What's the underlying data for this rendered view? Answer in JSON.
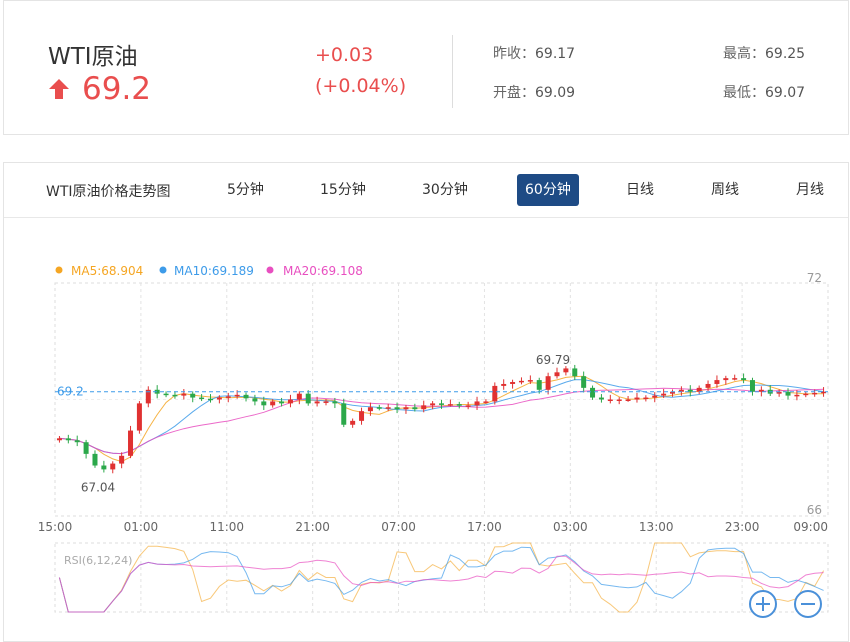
{
  "quote": {
    "name": "WTI原油",
    "last": "69.2",
    "change": "+0.03",
    "change_pct": "(+0.04%)",
    "prev_close_label": "昨收：",
    "prev_close": "69.17",
    "open_label": "开盘：",
    "open": "69.09",
    "high_label": "最高：",
    "high": "69.25",
    "low_label": "最低：",
    "low": "69.07",
    "up_color": "#e94e4e"
  },
  "tabs": {
    "title": "WTI原油价格走势图",
    "items": [
      "5分钟",
      "15分钟",
      "30分钟",
      "60分钟",
      "日线",
      "周线",
      "月线"
    ],
    "active": "60分钟",
    "active_color": "#1e4b85"
  },
  "legend": {
    "ma5": "MA5:68.904",
    "ma10": "MA10:69.189",
    "ma20": "MA20:69.108"
  },
  "chart_data": {
    "type": "candlestick",
    "y_axis_labels": [
      "72",
      "66"
    ],
    "ylim": [
      66,
      72
    ],
    "x_tick_labels": [
      "15:00",
      "01:00",
      "11:00",
      "21:00",
      "07:00",
      "17:00",
      "03:00",
      "13:00",
      "23:00",
      "09:00"
    ],
    "current_price_label": "69.2",
    "current_price": 69.2,
    "annotations": [
      {
        "label": "69.79",
        "value": 69.79
      },
      {
        "label": "67.04",
        "value": 67.04
      }
    ],
    "ma_colors": {
      "MA5": "#f5a623",
      "MA10": "#3d9be9",
      "MA20": "#e84fc0"
    },
    "close": [
      68.0,
      67.95,
      67.9,
      67.6,
      67.3,
      67.2,
      67.35,
      67.55,
      68.2,
      68.9,
      69.25,
      69.15,
      69.12,
      69.1,
      69.15,
      69.05,
      69.02,
      69.0,
      69.05,
      69.08,
      69.12,
      69.03,
      68.95,
      68.85,
      68.95,
      68.9,
      69.0,
      69.15,
      68.9,
      68.95,
      68.95,
      68.9,
      68.35,
      68.45,
      68.7,
      68.8,
      68.78,
      68.8,
      68.75,
      68.8,
      68.75,
      68.85,
      68.9,
      68.88,
      68.88,
      68.85,
      68.85,
      68.95,
      68.95,
      69.35,
      69.4,
      69.45,
      69.48,
      69.5,
      69.25,
      69.6,
      69.7,
      69.8,
      69.6,
      69.3,
      69.05,
      69.0,
      69.0,
      69.0,
      69.0,
      69.05,
      69.05,
      69.1,
      69.15,
      69.2,
      69.25,
      69.2,
      69.3,
      69.4,
      69.5,
      69.55,
      69.55,
      69.5,
      69.2,
      69.25,
      69.15,
      69.2,
      69.1,
      69.12,
      69.15,
      69.17,
      69.2
    ]
  },
  "rsi": {
    "label": "RSI(6,12,24)"
  }
}
